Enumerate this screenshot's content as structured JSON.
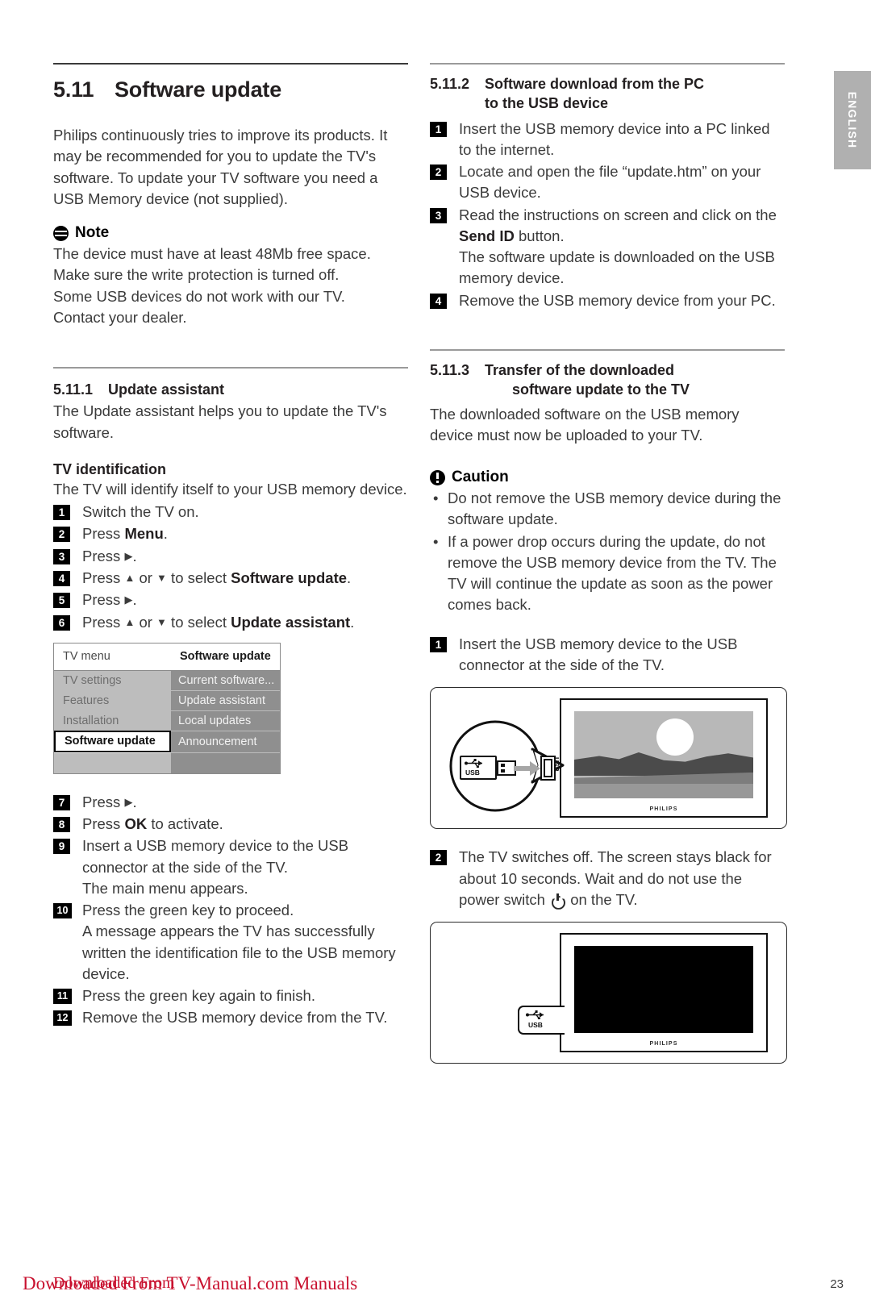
{
  "side_tab": {
    "label": "ENGLISH"
  },
  "left_column": {
    "section": {
      "number": "5.11",
      "title": "Software update"
    },
    "intro": "Philips continuously tries to improve its products. It may be recommended for you to update the TV's software. To update your TV software you need a USB Memory device (not supplied).",
    "note": {
      "icon": "note-icon",
      "heading": "Note",
      "lines": [
        "The device must have at least 48Mb free space.",
        "Make sure the write protection is turned off.",
        "Some USB devices do not work with our TV.",
        "Contact your dealer."
      ]
    },
    "subsection_1": {
      "number": "5.11.1",
      "title": "Update assistant",
      "body": "The Update assistant helps you to update the TV's software."
    },
    "tv_identification": {
      "heading": "TV identification",
      "body": "The TV will identify itself to your USB memory device.",
      "steps": [
        {
          "n": "1",
          "text": "Switch the TV on."
        },
        {
          "n": "2",
          "text": "Press ",
          "bold": "Menu",
          "after": "."
        },
        {
          "n": "3",
          "text": "Press ",
          "glyph": "▶",
          "after": "."
        },
        {
          "n": "4",
          "text": "Press ",
          "glyph2": "▲",
          "mid": " or ",
          "glyph3": "▼",
          "mid2": " to select ",
          "bold": "Software update",
          "after": "."
        },
        {
          "n": "5",
          "text": "Press ",
          "glyph": "▶",
          "after": "."
        },
        {
          "n": "6",
          "text": "Press ",
          "glyph2": "▲",
          "mid": " or ",
          "glyph3": "▼",
          "mid2": " to select ",
          "bold": "Update assistant",
          "after": "."
        }
      ]
    },
    "tv_menu_mock": {
      "header_left": "TV menu",
      "header_right": "Software update",
      "rows": [
        {
          "left": "TV settings",
          "right": "Current software..."
        },
        {
          "left": "Features",
          "right": "Update assistant"
        },
        {
          "left": "Installation",
          "right": "Local updates"
        },
        {
          "left": "Software update",
          "right": "Announcement",
          "selected": true
        },
        {
          "left": "",
          "right": ""
        }
      ]
    },
    "steps_after_menu": [
      {
        "n": "7",
        "text": "Press ",
        "glyph": "▶",
        "after": "."
      },
      {
        "n": "8",
        "text": " Press ",
        "bold": "OK",
        "after": " to activate."
      },
      {
        "n": "9",
        "text": " Insert a USB memory device to the USB connector at the side of the TV.",
        "cont": "The main menu appears."
      },
      {
        "n": "10",
        "text": "Press the green key to proceed.",
        "cont": "A message appears the TV has successfully written the identification file to the USB memory device."
      },
      {
        "n": "11",
        "text": "Press the green key again to finish."
      },
      {
        "n": "12",
        "text": "Remove the USB memory device from the TV."
      }
    ]
  },
  "right_column": {
    "subsection_2": {
      "number": "5.11.2",
      "title_line1": "Software download from the PC",
      "title_line2": "to the USB device",
      "steps": [
        {
          "n": "1",
          "text": "Insert the USB memory device into a PC linked to the internet."
        },
        {
          "n": "2",
          "text": "Locate and open the file “update.htm” on your USB device."
        },
        {
          "n": "3",
          "text": "Read the instructions on screen and click on the ",
          "bold": "Send ID",
          "after": " button.",
          "cont": "The software update is downloaded on the USB memory device."
        },
        {
          "n": "4",
          "text": "Remove the USB memory device from your PC."
        }
      ]
    },
    "subsection_3": {
      "number": "5.11.3",
      "title_line1": "Transfer of the downloaded",
      "title_line2": "software update to the TV",
      "body": "The downloaded software on the USB memory device must now be uploaded to your TV.",
      "caution": {
        "icon": "caution-icon",
        "heading": "Caution",
        "bullets": [
          "Do not remove the USB memory device during the software update.",
          "If a power drop occurs during the update, do not remove the USB memory device from the TV. The TV will continue the update as soon as the power comes back."
        ]
      },
      "steps": [
        {
          "n": "1",
          "text": "Insert the USB memory device to the USB connector at the side of the TV."
        },
        {
          "n": "2",
          "text": "The TV switches off. The screen stays black for about 10 seconds. Wait and do not use the power switch ",
          "glyph": "power-icon",
          "after": " on the TV."
        }
      ]
    },
    "illustration_1": {
      "name": "tv-usb-insert-illustration",
      "usb_plug_label": "USB",
      "usb_port_label": "USB",
      "brand": "PHILIPS",
      "screen": "sunset-landscape"
    },
    "illustration_2": {
      "name": "tv-black-screen-illustration",
      "usb_port_label": "USB",
      "brand": "PHILIPS",
      "screen": "black"
    }
  },
  "footer": {
    "watermark": "Downloaded From TV-Manual.com Manuals",
    "watermark_overlap": "Downloaded From",
    "page_number": "23"
  }
}
